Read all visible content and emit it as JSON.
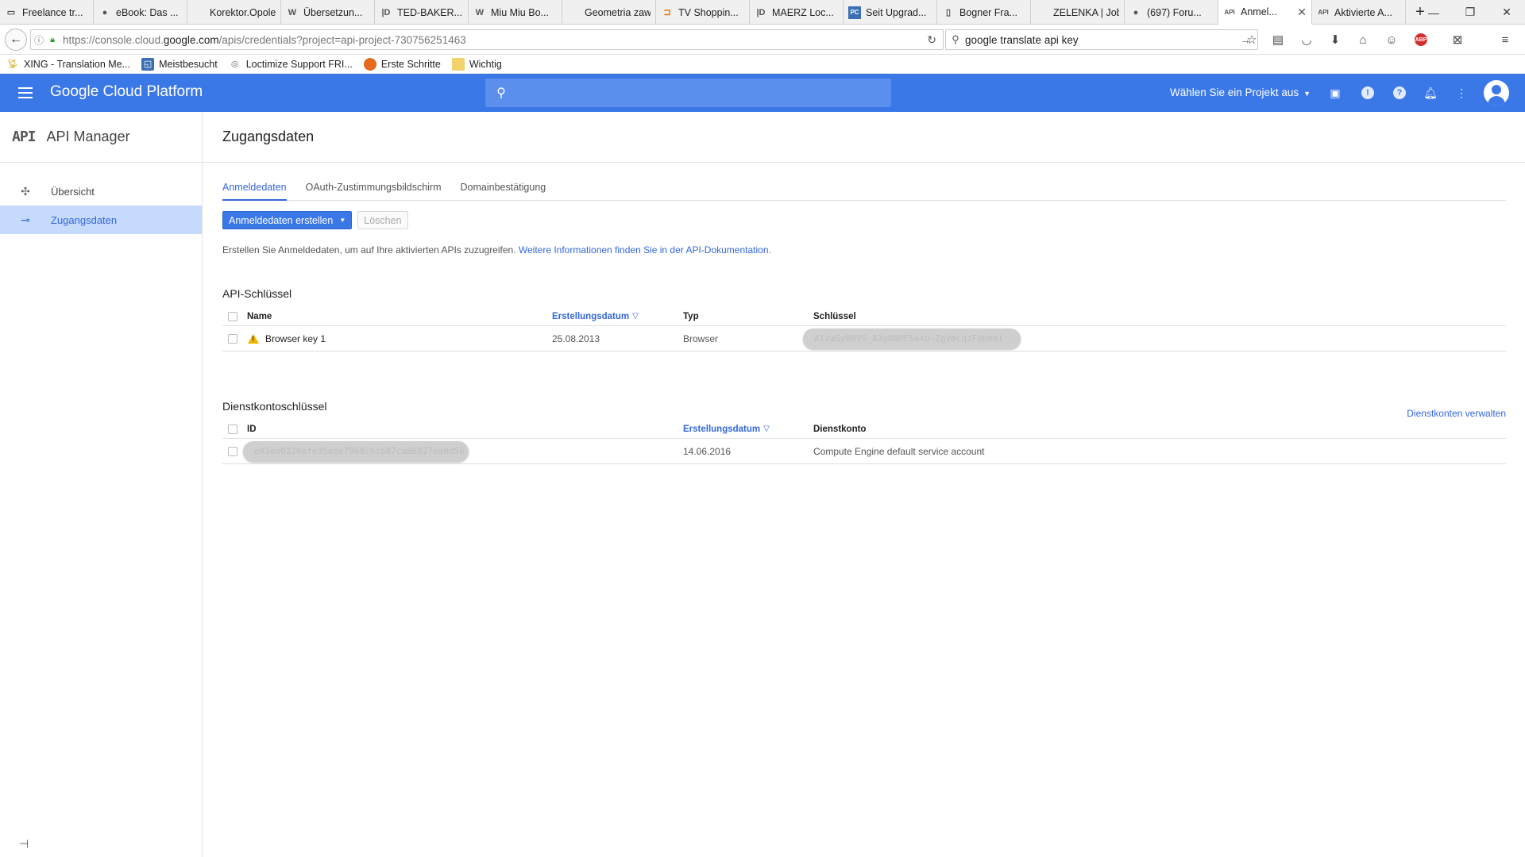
{
  "browser": {
    "tabs": [
      {
        "icon": "freelance-icon",
        "title": "Freelance tr..."
      },
      {
        "icon": "ebook-icon",
        "title": "eBook: Das ..."
      },
      {
        "icon": "page-icon",
        "title": "Korektor.Opole...."
      },
      {
        "icon": "wikipedia-icon",
        "title": "Übersetzun..."
      },
      {
        "icon": "ted-baker-icon",
        "title": "TED-BAKER..."
      },
      {
        "icon": "miu-miu-icon",
        "title": "Miu Miu Bo..."
      },
      {
        "icon": "page-icon",
        "title": "Geometria zawi..."
      },
      {
        "icon": "tv-shopping-icon",
        "title": "TV Shoppin..."
      },
      {
        "icon": "maerz-icon",
        "title": "MAERZ Loc..."
      },
      {
        "icon": "pc-icon",
        "title": "Seit Upgrad..."
      },
      {
        "icon": "page-icon",
        "title": "Bogner Fra..."
      },
      {
        "icon": "page-icon",
        "title": "ZELENKA | Jobs"
      },
      {
        "icon": "forum-icon",
        "title": "(697) Foru..."
      },
      {
        "icon": "api-icon",
        "title": "Anmel...",
        "active": true
      },
      {
        "icon": "api-icon",
        "title": "Aktivierte A..."
      }
    ],
    "url_prefix": "https://console.cloud.",
    "url_domain": "google.com",
    "url_suffix": "/apis/credentials?project=api-project-730756251463",
    "search_query": "google translate api key",
    "bookmarks": [
      {
        "icon": "xing-icon",
        "label": "XING - Translation Me..."
      },
      {
        "icon": "most-visited-icon",
        "label": "Meistbesucht"
      },
      {
        "icon": "loctimize-icon",
        "label": "Loctimize Support FRI..."
      },
      {
        "icon": "firefox-icon",
        "label": "Erste Schritte"
      },
      {
        "icon": "folder-icon",
        "label": "Wichtig"
      }
    ]
  },
  "header": {
    "brand": "Google Cloud Platform",
    "project_selector": "Wählen Sie ein Projekt aus"
  },
  "sidebar": {
    "logo": "API",
    "title": "API Manager",
    "items": [
      {
        "label": "Übersicht",
        "icon": "overview-icon",
        "active": false
      },
      {
        "label": "Zugangsdaten",
        "icon": "key-icon",
        "active": true
      }
    ]
  },
  "main": {
    "title": "Zugangsdaten",
    "tabs": [
      "Anmeldedaten",
      "OAuth-Zustimmungsbildschirm",
      "Domainbestätigung"
    ],
    "create_button": "Anmeldedaten erstellen",
    "delete_button": "Löschen",
    "intro_text": "Erstellen Sie Anmeldedaten, um auf Ihre aktivierten APIs zuzugreifen. ",
    "intro_link": "Weitere Informationen finden Sie in der API-Dokumentation.",
    "api_keys": {
      "title": "API-Schlüssel",
      "columns": [
        "Name",
        "Erstellungsdatum",
        "Typ",
        "Schlüssel"
      ],
      "rows": [
        {
          "name": "Browser key 1",
          "date": "25.08.2013",
          "type": "Browser",
          "key": "AIzaSyB0VS_A3gUAMFSoXo-ZgVmcqzFdbhbl"
        }
      ]
    },
    "service_accounts": {
      "title": "Dienstkontoschlüssel",
      "manage_link": "Dienstkonten verwalten",
      "columns": [
        "ID",
        "Erstellungsdatum",
        "Dienstkonto"
      ],
      "rows": [
        {
          "id": "e03ea0320afe35ebe7968c6c687ca86927ea0d56",
          "date": "14.06.2016",
          "account": "Compute Engine default service account"
        }
      ]
    }
  },
  "colors": {
    "header_blue": "#3b78e7",
    "link_blue": "#3367d6",
    "active_nav_bg": "#c6dafc",
    "warning": "#f4b400"
  }
}
